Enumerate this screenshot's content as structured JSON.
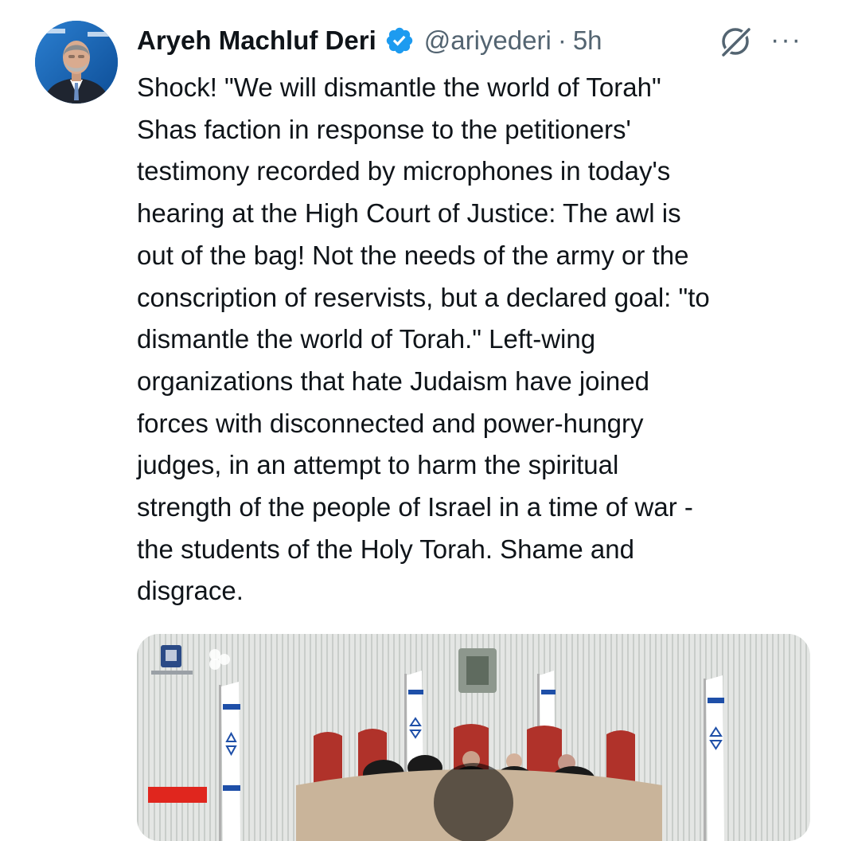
{
  "tweet": {
    "author_name": "Aryeh Machluf Deri",
    "handle": "@ariyederi",
    "separator": "·",
    "time": "5h",
    "more_label": "···",
    "text": "Shock! \"We will dismantle the world of Torah\"\nShas faction in response to the petitioners'\ntestimony recorded by microphones in today's\nhearing at the High Court of Justice: The awl is\nout of the bag! Not the needs of the army or the\nconscription of reservists, but a declared goal: \"to\ndismantle the world of Torah.\" Left-wing\norganizations that hate Judaism have joined\nforces with disconnected and power-hungry\njudges, in an attempt to harm the spiritual\nstrength of the people of Israel in a time of war -\nthe students of the Holy Torah. Shame and\ndisgrace."
  },
  "icons": {
    "verified": "verified-badge-icon",
    "grok": "grok-icon",
    "more": "more-options-icon"
  },
  "colors": {
    "verified_blue": "#1d9bf0",
    "text_primary": "#0f1419",
    "text_secondary": "#536471",
    "flag_blue": "#1e4fa8"
  }
}
